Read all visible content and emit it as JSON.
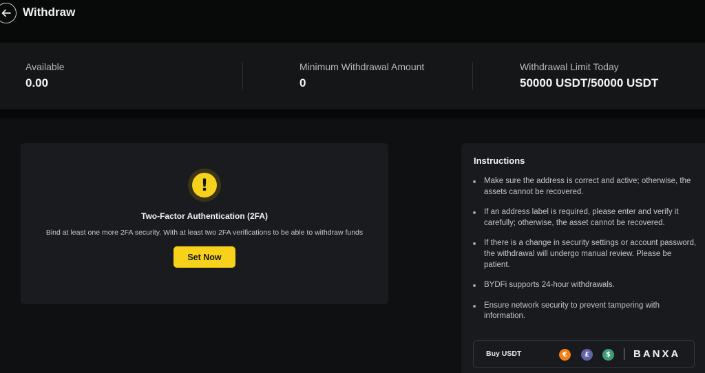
{
  "header": {
    "back_icon": "arrow-left-icon",
    "title": "Withdraw"
  },
  "stats": {
    "available": {
      "label": "Available",
      "value": "0.00"
    },
    "minimum": {
      "label": "Minimum Withdrawal Amount",
      "value": "0"
    },
    "limit": {
      "label": "Withdrawal Limit Today",
      "value": "50000 USDT/50000 USDT"
    }
  },
  "twofa": {
    "icon": "exclamation-warning-icon",
    "title": "Two-Factor Authentication (2FA)",
    "description": "Bind at least one more 2FA security. With at least two 2FA verifications to be able to withdraw funds",
    "button_label": "Set Now"
  },
  "instructions": {
    "title": "Instructions",
    "items": [
      "Make sure the address is correct and active; otherwise, the assets cannot be recovered.",
      "If an address label is required, please enter and verify it carefully; otherwise, the asset cannot be recovered.",
      "If there is a change in security settings or account password, the withdrawal will undergo manual review. Please be patient.",
      "BYDFi supports 24-hour withdrawals.",
      "Ensure network security to prevent tampering with information."
    ]
  },
  "buy": {
    "label": "Buy  USDT",
    "currencies": [
      {
        "symbol": "€",
        "icon": "euro-icon",
        "color": "#f07f14"
      },
      {
        "symbol": "£",
        "icon": "pound-icon",
        "color": "#6264a7"
      },
      {
        "symbol": "$",
        "icon": "dollar-icon",
        "color": "#3e9c76"
      }
    ],
    "provider": "BANXA"
  },
  "colors": {
    "accent": "#f8d11a",
    "background": "#0b0c0d",
    "card": "#191b1e"
  }
}
